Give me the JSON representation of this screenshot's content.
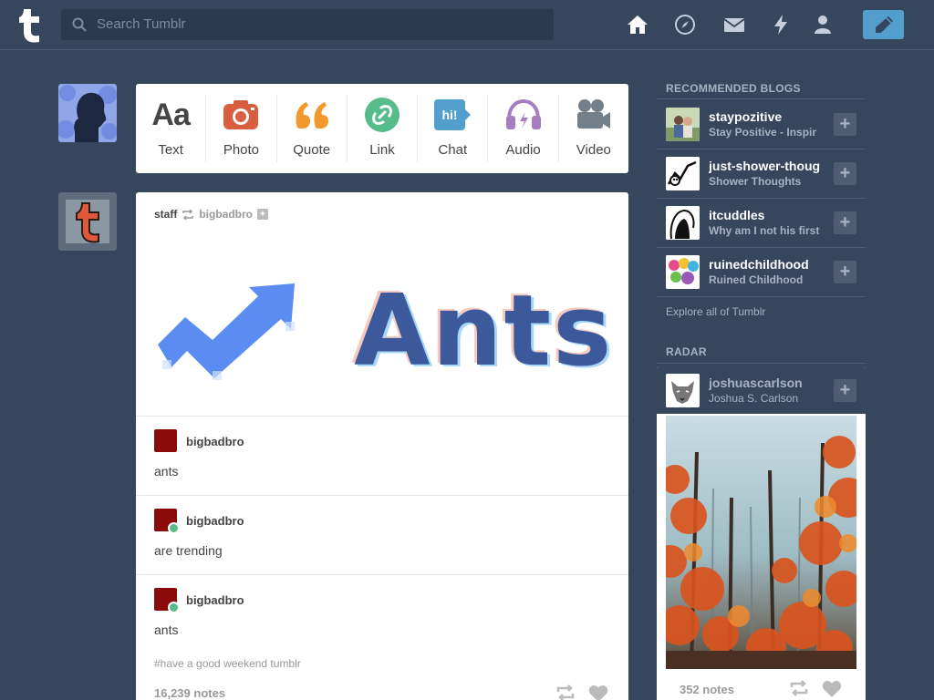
{
  "header": {
    "search_placeholder": "Search Tumblr",
    "nav_icons": [
      "home-icon",
      "explore-icon",
      "inbox-icon",
      "activity-icon",
      "account-icon",
      "compose-icon"
    ]
  },
  "post_types": [
    {
      "label": "Text",
      "icon": "text-icon",
      "color": "#444444"
    },
    {
      "label": "Photo",
      "icon": "camera-icon",
      "color": "#d95e40"
    },
    {
      "label": "Quote",
      "icon": "quote-icon",
      "color": "#f2992e"
    },
    {
      "label": "Link",
      "icon": "link-icon",
      "color": "#56bc8a"
    },
    {
      "label": "Chat",
      "icon": "chat-icon",
      "color": "#529ecc"
    },
    {
      "label": "Audio",
      "icon": "headphones-icon",
      "color": "#a77dc2"
    },
    {
      "label": "Video",
      "icon": "video-camera-icon",
      "color": "#748089"
    }
  ],
  "post": {
    "author": "staff",
    "reblogged_from": "bigbadbro",
    "image_text": "Ants",
    "entries": [
      {
        "name": "bigbadbro",
        "text": "ants"
      },
      {
        "name": "bigbadbro",
        "text": "are trending"
      },
      {
        "name": "bigbadbro",
        "text": "ants"
      }
    ],
    "tags": "#have a good weekend tumblr",
    "notes": "16,239 notes"
  },
  "sidebar": {
    "recommended_title": "RECOMMENDED BLOGS",
    "blogs": [
      {
        "name": "staypozitive",
        "title": "Stay Positive - Inspir"
      },
      {
        "name": "just-shower-thoug",
        "title": "Shower Thoughts"
      },
      {
        "name": "itcuddles",
        "title": "Why am I not his first"
      },
      {
        "name": "ruinedchildhood",
        "title": "Ruined Childhood"
      }
    ],
    "explore_label": "Explore all of Tumblr",
    "radar_title": "RADAR",
    "radar": {
      "name": "joshuascarlson",
      "title": "Joshua S. Carlson",
      "notes": "352 notes"
    }
  },
  "colors": {
    "background": "#36465d",
    "accent": "#529ecc",
    "card": "#ffffff"
  }
}
